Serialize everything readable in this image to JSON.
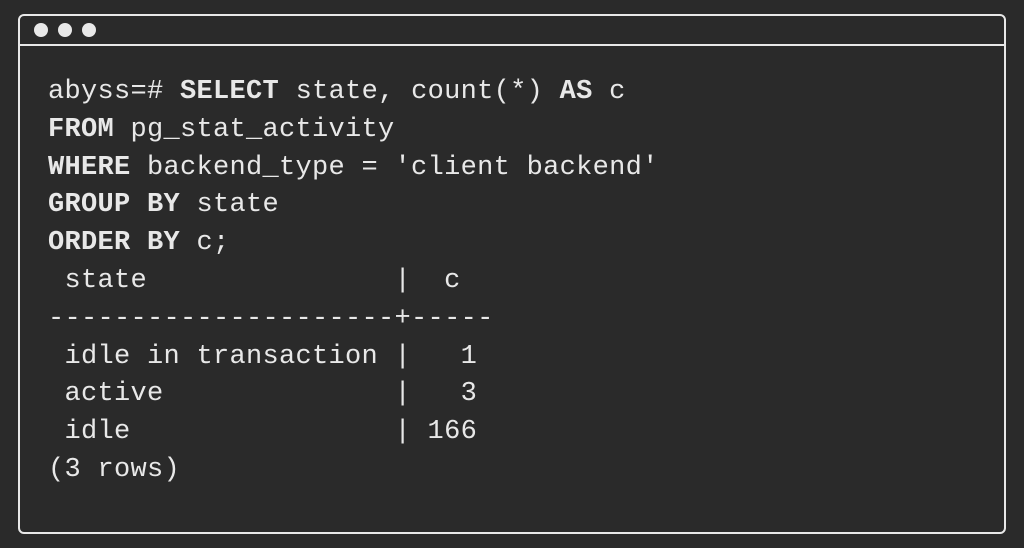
{
  "prompt": "abyss=# ",
  "query": {
    "select_kw": "SELECT",
    "select_rest": " state, count(*) ",
    "as_kw": "AS",
    "as_rest": " c",
    "from_kw": "FROM",
    "from_rest": " pg_stat_activity",
    "where_kw": "WHERE",
    "where_rest": " backend_type = 'client backend'",
    "groupby_kw": "GROUP BY",
    "groupby_rest": " state",
    "orderby_kw": "ORDER BY",
    "orderby_rest": " c;"
  },
  "result": {
    "header": " state               |  c",
    "divider": "---------------------+-----",
    "rows": [
      " idle in transaction |   1",
      " active              |   3",
      " idle                | 166"
    ],
    "footer": "(3 rows)"
  }
}
